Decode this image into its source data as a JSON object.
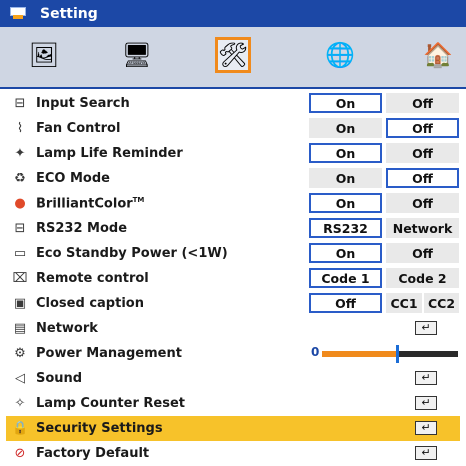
{
  "window": {
    "title": "Setting"
  },
  "tabs": [
    {
      "icon": "image-settings-icon",
      "glyph": "🖼",
      "selected": false
    },
    {
      "icon": "display-settings-icon",
      "glyph": "🖥",
      "selected": false
    },
    {
      "icon": "setup-icon",
      "glyph": "🛠",
      "selected": true
    },
    {
      "icon": "network-globe-icon",
      "glyph": "🌐",
      "selected": false
    },
    {
      "icon": "language-info-icon",
      "glyph": "🏠",
      "selected": false
    }
  ],
  "items": [
    {
      "label": "Input Search",
      "icon": "input-search-icon",
      "glyph": "⊟",
      "opt1": "On",
      "opt2": "Off",
      "active": "opt1"
    },
    {
      "label": "Fan Control",
      "icon": "fan-icon",
      "glyph": "⌇",
      "opt1": "On",
      "opt2": "Off",
      "active": "opt2"
    },
    {
      "label": "Lamp Life Reminder",
      "icon": "lamp-reminder-icon",
      "glyph": "✦",
      "opt1": "On",
      "opt2": "Off",
      "active": "opt1"
    },
    {
      "label": "ECO Mode",
      "icon": "eco-mode-icon",
      "glyph": "♻",
      "opt1": "On",
      "opt2": "Off",
      "active": "opt2"
    },
    {
      "label": "BrilliantColor",
      "tm": "TM",
      "icon": "brilliantcolor-icon",
      "glyph": "●",
      "opt1": "On",
      "opt2": "Off",
      "active": "opt1"
    },
    {
      "label": "RS232 Mode",
      "icon": "rs232-icon",
      "glyph": "⊟",
      "opt1": "RS232",
      "opt2": "Network",
      "active": "opt1"
    },
    {
      "label": "Eco Standby Power (<1W)",
      "icon": "standby-power-icon",
      "glyph": "▭",
      "opt1": "On",
      "opt2": "Off",
      "active": "opt1"
    },
    {
      "label": "Remote control",
      "icon": "remote-control-icon",
      "glyph": "⌧",
      "opt1": "Code 1",
      "opt2": "Code 2",
      "active": "opt1"
    },
    {
      "label": "Closed caption",
      "icon": "closed-caption-icon",
      "glyph": "▣",
      "opt1": "Off",
      "cc1": "CC1",
      "cc2": "CC2",
      "active": "opt1"
    },
    {
      "label": "Network",
      "icon": "network-icon",
      "glyph": "▤",
      "enter_glyph": "↵"
    },
    {
      "label": "Power Management",
      "icon": "power-management-icon",
      "glyph": "⚙",
      "value": "0",
      "level_percent": 55
    },
    {
      "label": "Sound",
      "icon": "sound-icon",
      "glyph": "◁",
      "enter_glyph": "↵"
    },
    {
      "label": "Lamp Counter Reset",
      "icon": "lamp-counter-reset-icon",
      "glyph": "✧",
      "enter_glyph": "↵"
    },
    {
      "label": "Security Settings",
      "icon": "security-lock-icon",
      "glyph": "🔒",
      "enter_glyph": "↵",
      "selected": true
    },
    {
      "label": "Factory Default",
      "icon": "factory-default-icon",
      "glyph": "⊘",
      "enter_glyph": "↵"
    }
  ],
  "colors": {
    "title_bar": "#1c48a6",
    "selection": "#f7c22a",
    "active_border": "#2a5cc8",
    "tab_selected": "#f08a1c"
  }
}
